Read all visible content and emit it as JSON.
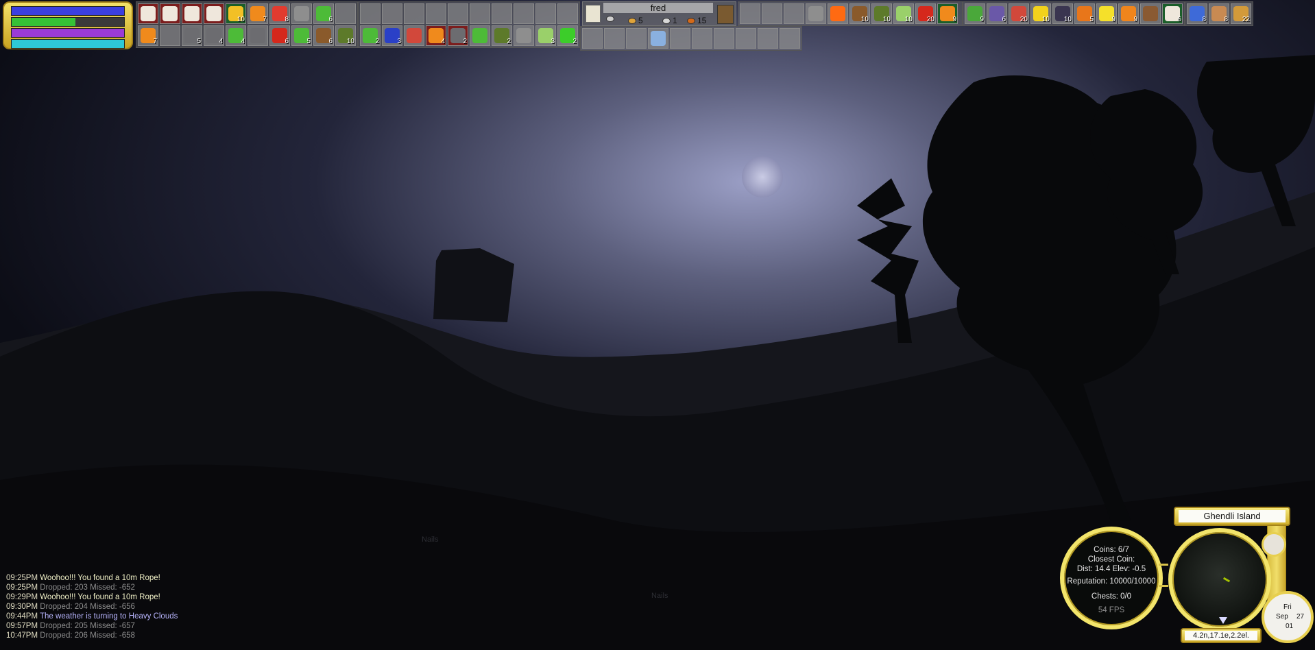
{
  "status_bars": [
    {
      "name": "health",
      "fraction": 1.0,
      "color": "#3b3fe0"
    },
    {
      "name": "stamina",
      "fraction": 0.57,
      "color": "#36c236"
    },
    {
      "name": "mana",
      "fraction": 1.0,
      "color": "#9a3bd6"
    },
    {
      "name": "thirst",
      "fraction": 1.0,
      "color": "#2ec8d6"
    }
  ],
  "inventory": {
    "bag1_row1": [
      {
        "icon": "paper-icon",
        "qty": "",
        "tone": "red"
      },
      {
        "icon": "paper-icon",
        "qty": "",
        "tone": "red"
      },
      {
        "icon": "paper-icon",
        "qty": "",
        "tone": "red"
      },
      {
        "icon": "paper-icon",
        "qty": "",
        "tone": "red"
      },
      {
        "icon": "flower-icon",
        "qty": "10",
        "tone": "green"
      },
      {
        "icon": "orange-flower-icon",
        "qty": "7",
        "tone": ""
      },
      {
        "icon": "tomato-icon",
        "qty": "8",
        "tone": ""
      },
      {
        "icon": "stone-icon",
        "qty": "",
        "tone": ""
      },
      {
        "icon": "leaf-icon",
        "qty": "6",
        "tone": ""
      },
      {
        "icon": "",
        "qty": "",
        "tone": ""
      }
    ],
    "bag1_row2": [
      {
        "icon": "orange-flower-icon",
        "qty": "7",
        "tone": ""
      },
      {
        "icon": "",
        "qty": "",
        "tone": ""
      },
      {
        "icon": "horse-head-icon",
        "qty": "5",
        "tone": ""
      },
      {
        "icon": "horse-head-icon",
        "qty": "4",
        "tone": ""
      },
      {
        "icon": "leaf-icon",
        "qty": "4",
        "tone": ""
      },
      {
        "icon": "horse-head-icon",
        "qty": "",
        "tone": ""
      },
      {
        "icon": "chili-icon",
        "qty": "6",
        "tone": ""
      },
      {
        "icon": "leaf-icon",
        "qty": "5",
        "tone": ""
      },
      {
        "icon": "wood-log-icon",
        "qty": "6",
        "tone": ""
      },
      {
        "icon": "avocado-icon",
        "qty": "10",
        "tone": ""
      }
    ],
    "bag2_row1": [
      {
        "icon": "",
        "qty": "",
        "tone": ""
      },
      {
        "icon": "",
        "qty": "",
        "tone": ""
      },
      {
        "icon": "",
        "qty": "",
        "tone": ""
      },
      {
        "icon": "",
        "qty": "",
        "tone": ""
      },
      {
        "icon": "",
        "qty": "",
        "tone": ""
      },
      {
        "icon": "",
        "qty": "",
        "tone": ""
      },
      {
        "icon": "",
        "qty": "",
        "tone": ""
      },
      {
        "icon": "",
        "qty": "",
        "tone": ""
      },
      {
        "icon": "",
        "qty": "",
        "tone": ""
      },
      {
        "icon": "",
        "qty": "",
        "tone": ""
      }
    ],
    "bag2_row2": [
      {
        "icon": "leaf-icon",
        "qty": "2",
        "tone": ""
      },
      {
        "icon": "blue-crystal-icon",
        "qty": "3",
        "tone": ""
      },
      {
        "icon": "meat-icon",
        "qty": "",
        "tone": ""
      },
      {
        "icon": "orange-flower-icon",
        "qty": "4",
        "tone": "red"
      },
      {
        "icon": "horse-head-icon",
        "qty": "2",
        "tone": "red"
      },
      {
        "icon": "leaf-icon",
        "qty": "",
        "tone": ""
      },
      {
        "icon": "avocado-icon",
        "qty": "2",
        "tone": ""
      },
      {
        "icon": "stone-icon",
        "qty": "",
        "tone": ""
      },
      {
        "icon": "herb-icon",
        "qty": "3",
        "tone": ""
      },
      {
        "icon": "green-apple-icon",
        "qty": "2",
        "tone": ""
      }
    ],
    "bag3_row1": [
      {
        "icon": "",
        "qty": "",
        "tone": ""
      },
      {
        "icon": "",
        "qty": "",
        "tone": ""
      },
      {
        "icon": "",
        "qty": "",
        "tone": ""
      },
      {
        "icon": "stone-icon",
        "qty": "",
        "tone": ""
      },
      {
        "icon": "fire-icon",
        "qty": "",
        "tone": ""
      },
      {
        "icon": "wood-log-icon",
        "qty": "10",
        "tone": ""
      },
      {
        "icon": "avocado-icon",
        "qty": "10",
        "tone": ""
      },
      {
        "icon": "herb-icon",
        "qty": "10",
        "tone": ""
      },
      {
        "icon": "chili-icon",
        "qty": "20",
        "tone": ""
      },
      {
        "icon": "orange-flower-icon",
        "qty": "9",
        "tone": "green"
      }
    ],
    "bag3_row2": [
      {
        "icon": "",
        "qty": "",
        "tone": ""
      },
      {
        "icon": "",
        "qty": "",
        "tone": ""
      },
      {
        "icon": "",
        "qty": "",
        "tone": ""
      },
      {
        "icon": "rope-icon",
        "qty": "",
        "tone": ""
      },
      {
        "icon": "",
        "qty": "",
        "tone": ""
      },
      {
        "icon": "",
        "qty": "",
        "tone": ""
      },
      {
        "icon": "",
        "qty": "",
        "tone": ""
      },
      {
        "icon": "",
        "qty": "",
        "tone": ""
      },
      {
        "icon": "",
        "qty": "",
        "tone": ""
      },
      {
        "icon": "",
        "qty": "",
        "tone": ""
      }
    ],
    "bag4_row1": [
      {
        "icon": "pepper-icon",
        "qty": "9",
        "tone": ""
      },
      {
        "icon": "grapes-icon",
        "qty": "6",
        "tone": ""
      },
      {
        "icon": "meat-icon",
        "qty": "20",
        "tone": ""
      },
      {
        "icon": "banana-icon",
        "qty": "10",
        "tone": ""
      },
      {
        "icon": "blackberry-icon",
        "qty": "10",
        "tone": ""
      },
      {
        "icon": "pumpkin-icon",
        "qty": "5",
        "tone": ""
      },
      {
        "icon": "lemon-icon",
        "qty": "9",
        "tone": ""
      },
      {
        "icon": "orange-icon",
        "qty": "9",
        "tone": ""
      },
      {
        "icon": "horse-icon",
        "qty": "",
        "tone": ""
      },
      {
        "icon": "paper-icon",
        "qty": "6",
        "tone": "green"
      }
    ],
    "bag5_row1": [
      {
        "icon": "potion-icon",
        "qty": "8",
        "tone": ""
      },
      {
        "icon": "bread-icon",
        "qty": "8",
        "tone": ""
      },
      {
        "icon": "tiger-icon",
        "qty": "22",
        "tone": ""
      }
    ]
  },
  "character": {
    "name": "fred",
    "silver": "5",
    "gold": "1",
    "copper": "15"
  },
  "chat": [
    {
      "time": "09:25PM",
      "msg": "Woohoo!!! You found a 10m Rope!",
      "tone": "yellow"
    },
    {
      "time": "09:25PM",
      "msg": "Dropped: 203  Missed: -652",
      "tone": "gray"
    },
    {
      "time": "09:29PM",
      "msg": "Woohoo!!! You found a 10m Rope!",
      "tone": "yellow"
    },
    {
      "time": "09:30PM",
      "msg": "Dropped: 204  Missed: -656",
      "tone": "gray"
    },
    {
      "time": "09:44PM",
      "msg": "The weather is turning to Heavy Clouds",
      "tone": "blue"
    },
    {
      "time": "09:57PM",
      "msg": "Dropped: 205  Missed: -657",
      "tone": "gray"
    },
    {
      "time": "10:47PM",
      "msg": "Dropped: 206  Missed: -658",
      "tone": "gray"
    }
  ],
  "hud": {
    "coins": "Coins: 6/7",
    "closest_coin": "Closest Coin:",
    "dist": "Dist: 14.4  Elev: -0.5",
    "reputation": "Reputation: 10000/10000",
    "chests": "Chests: 0/0",
    "fps": "54 FPS",
    "location": "Ghendli Island",
    "coords": "4.2n,17.1e,2.2el.",
    "clock_day": "Fri",
    "clock_month": "Sep",
    "clock_date": "27",
    "clock_year": "01"
  },
  "world_labels": [
    "Nails",
    "Nails"
  ]
}
